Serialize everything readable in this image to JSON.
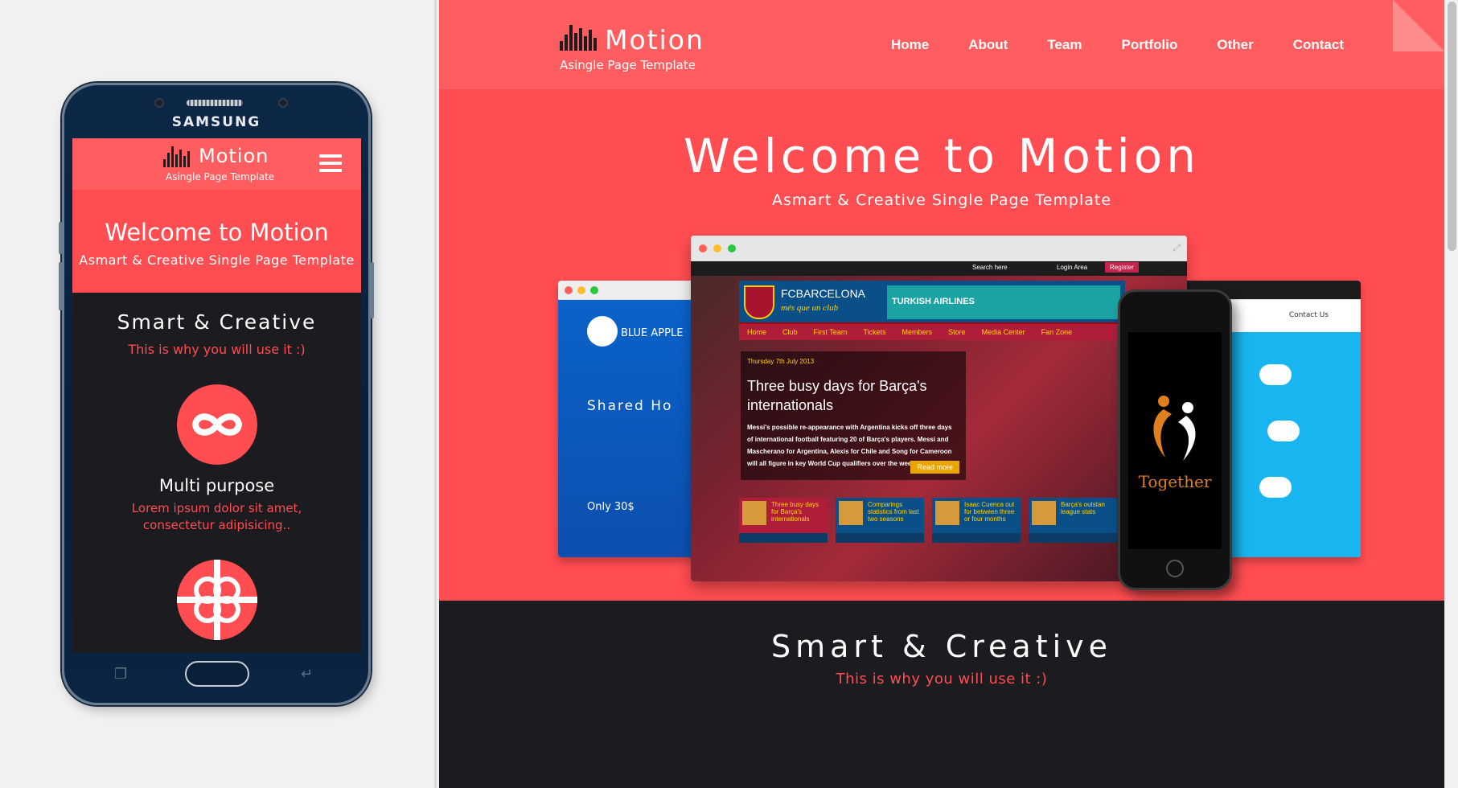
{
  "brand": {
    "name": "Motion",
    "tagline": "Asingle Page Template",
    "accent": "#ff4d51",
    "header_color": "#ff5d5f",
    "dark_bg": "#1b1b20"
  },
  "desktop": {
    "nav": [
      "Home",
      "About",
      "Team",
      "Portfolio",
      "Other",
      "Contact"
    ],
    "hero": {
      "title": "Welcome to Motion",
      "subtitle": "Asmart & Creative Single Page Template"
    },
    "section": {
      "title": "Smart & Creative",
      "subtitle": "This is why you will use it :)"
    },
    "mockup": {
      "left_brand": "BLUE APPLE",
      "left_heading": "Shared Ho",
      "left_price": "Only 30$",
      "right_link": "Contact Us",
      "center_site": {
        "club_name": "FCBARCELONA",
        "club_motto": "més que un club",
        "sponsor": "TURKISH AIRLINES",
        "search_placeholder": "Search here",
        "login": "Login Area",
        "register": "Register",
        "menu": [
          "Home",
          "Club",
          "First Team",
          "Tickets",
          "Members",
          "Store",
          "Media Center",
          "Fan Zone"
        ],
        "article_date": "Thursday 7th July 2013",
        "article_title": "Three busy days for Barça's internationals",
        "article_body": "Messi's possible re-appearance with Argentina kicks off three days of international football featuring 20 of Barça's players. Messi and Mascherano for Argentina, Alexis for Chile and Song for Cameroon will all figure in key World Cup qualifiers over the weekend .....",
        "read_more": "Read more",
        "thumbs": [
          "Three busy days for Barça's internationals",
          "Comparings statistics from last two seasons",
          "Isaac Cuenca out for between three or four months",
          "Barça's outstan league stats"
        ]
      },
      "iphone_text": "Together"
    }
  },
  "mobile": {
    "device_brand": "SAMSUNG",
    "hero": {
      "title": "Welcome to Motion",
      "subtitle": "Asmart & Creative Single Page Template"
    },
    "section": {
      "title": "Smart & Creative",
      "subtitle": "This is why you will use it :)"
    },
    "feature": {
      "title": "Multi purpose",
      "text_line1": "Lorem ipsum dolor sit amet,",
      "text_line2": "consectetur adipisicing.."
    }
  }
}
